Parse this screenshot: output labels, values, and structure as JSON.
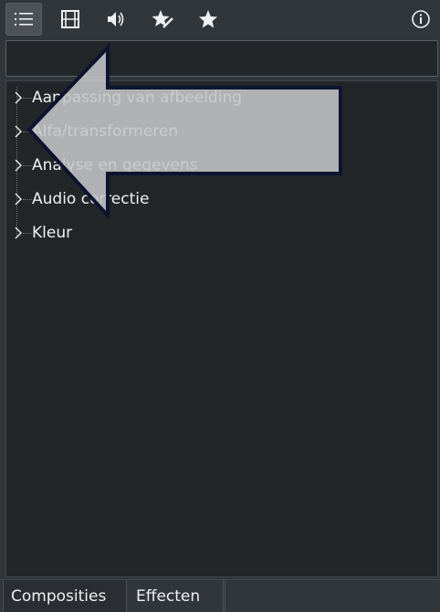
{
  "toolbar": {
    "buttons": [
      {
        "name": "list-view",
        "icon": "list-icon",
        "active": true
      },
      {
        "name": "video-effects",
        "icon": "film-icon",
        "active": false
      },
      {
        "name": "audio-effects",
        "icon": "speaker-icon",
        "active": false
      },
      {
        "name": "custom-effects",
        "icon": "star-edit-icon",
        "active": false
      },
      {
        "name": "favorites",
        "icon": "star-icon",
        "active": false
      },
      {
        "name": "info",
        "icon": "info-icon",
        "active": false
      }
    ]
  },
  "search": {
    "value": "",
    "placeholder": ""
  },
  "tree": {
    "items": [
      {
        "label": "Aanpassing van afbeelding"
      },
      {
        "label": "Alfa/transformeren"
      },
      {
        "label": "Analyse en gegevens"
      },
      {
        "label": "Audio correctie"
      },
      {
        "label": "Kleur"
      }
    ]
  },
  "tabs": [
    {
      "label": "Composities",
      "active": true
    },
    {
      "label": "Effecten",
      "active": false
    }
  ],
  "colors": {
    "background": "#31363b",
    "panel": "#232629",
    "text": "#eff0f1",
    "overlay_arrow_fill": "#c4c5c7",
    "overlay_arrow_stroke": "#0d1430"
  }
}
